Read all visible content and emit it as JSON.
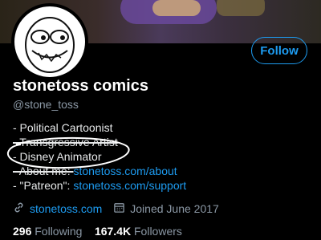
{
  "profile": {
    "display_name": "stonetoss comics",
    "handle": "@stone_toss",
    "follow_label": "Follow",
    "bio": {
      "line1": "- Political Cartoonist",
      "line2": "- Transgressive Artist",
      "line3": "- Disney Animator",
      "line4_prefix": "- About me: ",
      "line4_link": "stonetoss.com/about",
      "line5_prefix": "- \"Patreon\": ",
      "line5_link": "stonetoss.com/support"
    },
    "website": "stonetoss.com",
    "joined": "Joined June 2017",
    "following_count": "296",
    "following_label": "Following",
    "followers_count": "167.4K",
    "followers_label": "Followers"
  },
  "colors": {
    "accent": "#1d9bf0",
    "background": "#000000",
    "secondary_text": "#8b98a5"
  },
  "icons": {
    "website": "link-icon",
    "joined": "calendar-icon"
  }
}
